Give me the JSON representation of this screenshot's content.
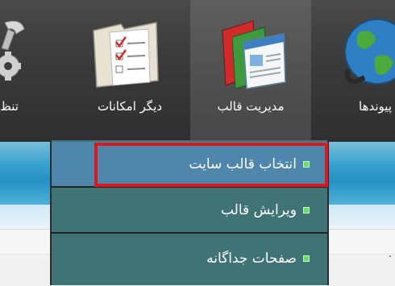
{
  "toolbar": {
    "items": [
      {
        "label": "تنظ",
        "icon": "settings-gear-wrench-icon"
      },
      {
        "label": "دیگر امکانات",
        "icon": "folder-checklist-icon"
      },
      {
        "label": "مدیریت قالب",
        "icon": "template-pages-icon",
        "active": true
      },
      {
        "label": "پیوندها",
        "icon": "globe-link-icon"
      }
    ]
  },
  "dropdown": {
    "items": [
      {
        "label": "انتخاب قالب سایت",
        "highlighted": true
      },
      {
        "label": "ویرایش قالب"
      },
      {
        "label": "صفحات جداگانه"
      }
    ],
    "bullet_color": "#5fe25f",
    "highlight_color": "#e0161f"
  },
  "bottom": {
    "trailing_char": "."
  }
}
